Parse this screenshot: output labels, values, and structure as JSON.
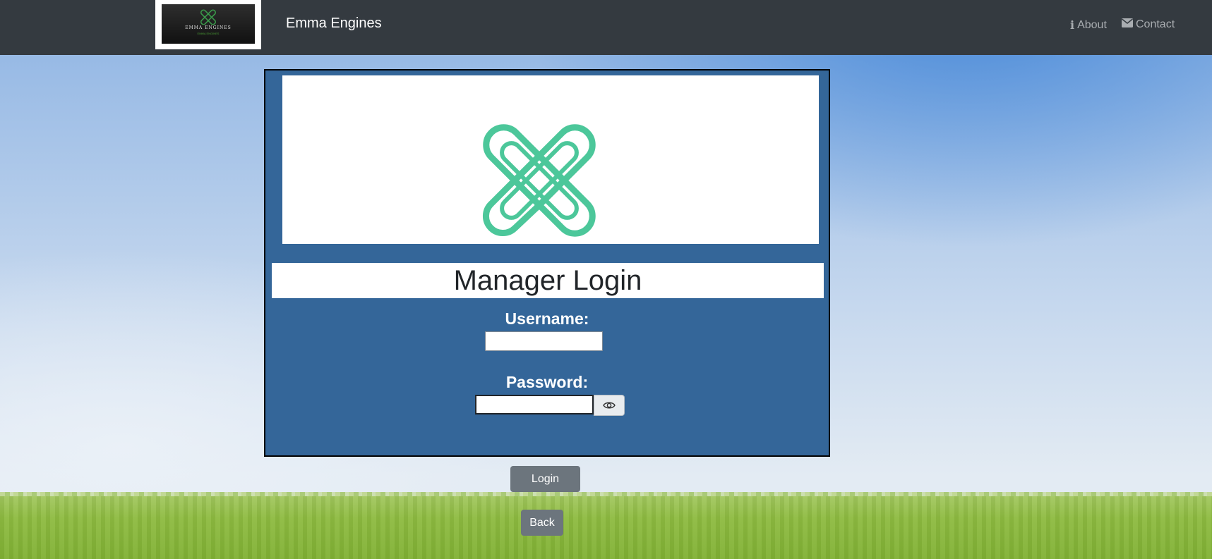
{
  "navbar": {
    "brand_name": "Emma Engines",
    "logo_text": "EMMA ENGINES",
    "logo_subtext": "EMMA ENGINES",
    "links": {
      "about": "About",
      "contact": "Contact"
    }
  },
  "login": {
    "title": "Manager Login",
    "username_label": "Username:",
    "username_value": "",
    "password_label": "Password:",
    "password_value": "",
    "login_button": "Login",
    "back_button": "Back"
  },
  "icons": {
    "about": "info-icon",
    "contact": "envelope-icon",
    "show_password": "eye-icon",
    "brand_logo": "knot-logo-icon"
  },
  "colors": {
    "navbar_bg": "#343a40",
    "panel_bg": "#346699",
    "logo_green": "#4cc79a",
    "button_bg": "#6c757d"
  }
}
